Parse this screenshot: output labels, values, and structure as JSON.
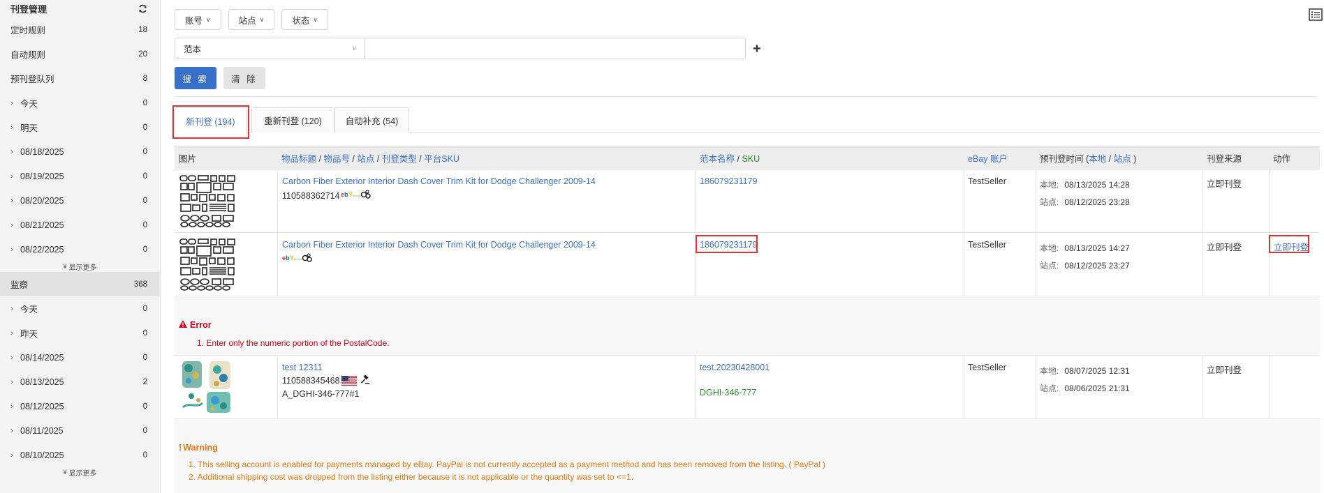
{
  "sidebar": {
    "title": "刊登管理",
    "items": [
      {
        "label": "定时规则",
        "count": "18"
      },
      {
        "label": "自动规则",
        "count": "20"
      },
      {
        "label": "预刊登队列",
        "count": "8"
      },
      {
        "label": "今天",
        "count": "0"
      },
      {
        "label": "明天",
        "count": "0"
      },
      {
        "label": "08/18/2025",
        "count": "0"
      },
      {
        "label": "08/19/2025",
        "count": "0"
      },
      {
        "label": "08/20/2025",
        "count": "0"
      },
      {
        "label": "08/21/2025",
        "count": "0"
      },
      {
        "label": "08/22/2025",
        "count": "0"
      }
    ],
    "show_more": "显示更多",
    "monitor": {
      "label": "监察",
      "count": "368"
    },
    "monitor_items": [
      {
        "label": "今天",
        "count": "0"
      },
      {
        "label": "昨天",
        "count": "0"
      },
      {
        "label": "08/14/2025",
        "count": "0"
      },
      {
        "label": "08/13/2025",
        "count": "2"
      },
      {
        "label": "08/12/2025",
        "count": "0"
      },
      {
        "label": "08/11/2025",
        "count": "0"
      },
      {
        "label": "08/10/2025",
        "count": "0"
      }
    ],
    "show_more_2": "显示更多"
  },
  "filters": {
    "account": "账号",
    "site": "站点",
    "status": "状态"
  },
  "search": {
    "select_value": "范本",
    "input_value": "",
    "search_label": "搜 索",
    "clear_label": "清 除"
  },
  "tabs": [
    {
      "label": "新刊登 (194)"
    },
    {
      "label": "重新刊登 (120)"
    },
    {
      "label": "自动补充 (54)"
    }
  ],
  "table": {
    "headers": {
      "image": "图片",
      "title_parts": [
        "物品标题",
        "物品号",
        "站点",
        "刊登类型",
        "平台SKU"
      ],
      "template_name": "范本名称",
      "sku": "SKU",
      "account": "eBay 账户",
      "pre_time": "预刊登时间",
      "local": "本地",
      "site": "站点",
      "source": "刊登来源",
      "action": "动作"
    },
    "rows": [
      {
        "title": "Carbon Fiber Exterior Interior Dash Cover Trim Kit for Dodge Challenger 2009-14",
        "item_id": "110588362714",
        "template": "186079231179",
        "sku": "",
        "account": "TestSeller",
        "local_label": "本地:",
        "local_time": "08/13/2025 14:28",
        "site_label": "站点:",
        "site_time": "08/12/2025 23:28",
        "source": "立即刊登",
        "action": ""
      },
      {
        "title": "Carbon Fiber Exterior Interior Dash Cover Trim Kit for Dodge Challenger 2009-14",
        "item_id": "",
        "template": "186079231179",
        "sku": "",
        "account": "TestSeller",
        "local_label": "本地:",
        "local_time": "08/13/2025 14:27",
        "site_label": "站点:",
        "site_time": "08/12/2025 23:27",
        "source": "立即刊登",
        "action": "立即刊登"
      },
      {
        "title": "test 12311",
        "item_id": "110588345468",
        "platform_sku": "A_DGHI-346-777#1",
        "template": "test.20230428001",
        "sku": "DGHI-346-777",
        "account": "TestSeller",
        "local_label": "本地:",
        "local_time": "08/07/2025 12:31",
        "site_label": "站点:",
        "site_time": "08/06/2025 21:31",
        "source": "立即刊登",
        "action": ""
      }
    ],
    "error": {
      "title": "Error",
      "lines": [
        "1. Enter only the numeric portion of the PostalCode."
      ]
    },
    "warning": {
      "title": "Warning",
      "lines": [
        "1. This selling account is enabled for payments managed by eBay. PayPal is not currently accepted as a payment method and has been removed from the listing. ( PayPal )",
        "2. Additional shipping cost was dropped from the listing either because it is not applicable or the quantity was set to <=1."
      ]
    }
  },
  "colors": {
    "link": "#3a6fc7",
    "error": "#d0021b",
    "warning": "#e07a10",
    "sku_green": "#2e8b2e",
    "highlight_box": "#e03030"
  }
}
